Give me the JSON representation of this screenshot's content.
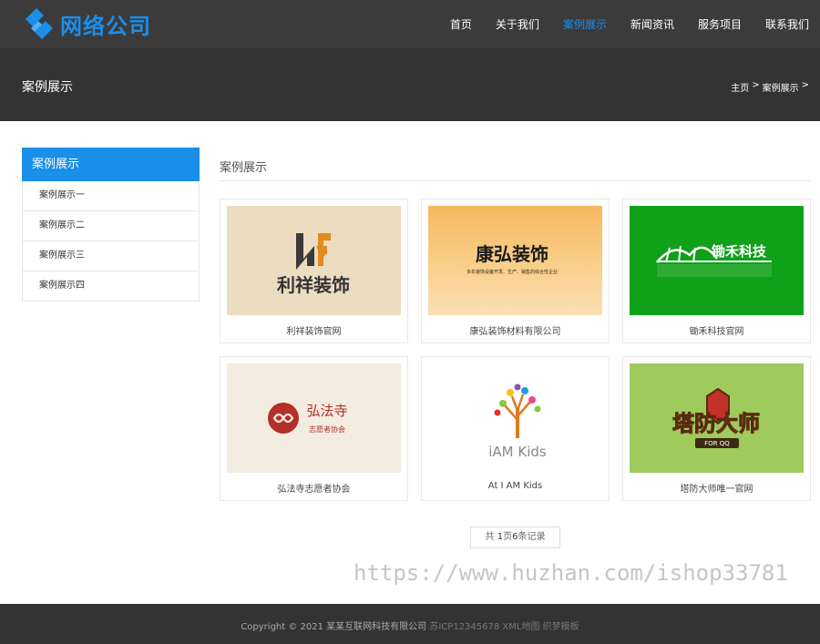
{
  "header": {
    "logo_text": "网络公司",
    "brand_color": "#1a8fe8",
    "nav": [
      {
        "label": "首页",
        "active": false
      },
      {
        "label": "关于我们",
        "active": false
      },
      {
        "label": "案例展示",
        "active": true
      },
      {
        "label": "新闻资讯",
        "active": false
      },
      {
        "label": "服务项目",
        "active": false
      },
      {
        "label": "联系我们",
        "active": false
      }
    ]
  },
  "banner": {
    "title": "案例展示",
    "breadcrumb": [
      "主页",
      ">",
      "案例展示",
      ">"
    ]
  },
  "sidebar": {
    "heading": "案例展示",
    "items": [
      "案例展示一",
      "案例展示二",
      "案例展示三",
      "案例展示四"
    ]
  },
  "main": {
    "title": "案例展示",
    "cards": [
      {
        "caption": "利祥装饰官网",
        "logo_text": "利祥装饰"
      },
      {
        "caption": "康弘装饰材料有限公司",
        "logo_text": "康弘装饰",
        "logo_subtext": "多年装饰设备开发、生产、销售的综合性企业"
      },
      {
        "caption": "锄禾科技官网",
        "logo_text": "锄禾科技"
      },
      {
        "caption": "弘法寺志愿者协会",
        "logo_text": "弘法寺",
        "logo_subtext": "志愿者协会"
      },
      {
        "caption": "At I AM Kids",
        "logo_text": "iAM Kids"
      },
      {
        "caption": "塔防大师唯一官网",
        "logo_text": "塔防大师",
        "logo_subtext": "FOR QQ"
      }
    ],
    "pager": {
      "prefix": "共",
      "pages": "1",
      "mid": "页",
      "records": "6",
      "suffix": "条记录"
    }
  },
  "watermark": "https://www.huzhan.com/ishop33781",
  "footer": {
    "copyright": "Copyright © 2021 某某互联网科技有限公司",
    "icp": "苏ICP12345678",
    "sitemap": "XML地图",
    "template": "织梦模板"
  }
}
